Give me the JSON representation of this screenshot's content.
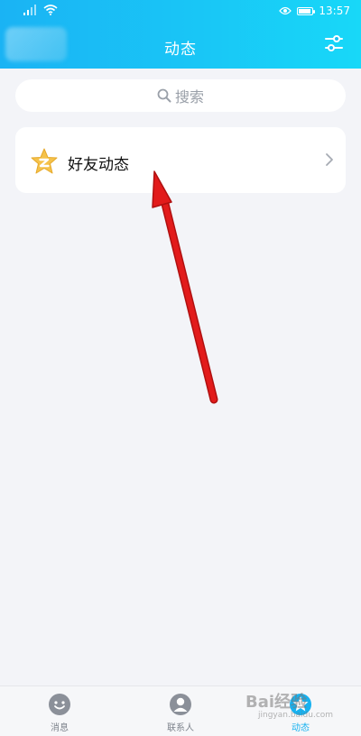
{
  "status_bar": {
    "time": "13:57"
  },
  "header": {
    "title": "动态",
    "filter_icon": "sliders-icon"
  },
  "search": {
    "placeholder": "搜索"
  },
  "feed": {
    "items": [
      {
        "label": "好友动态",
        "icon": "qzone-star-icon"
      }
    ]
  },
  "tab_bar": {
    "items": [
      {
        "label": "消息",
        "icon": "message-icon",
        "active": false
      },
      {
        "label": "联系人",
        "icon": "contacts-icon",
        "active": false
      },
      {
        "label": "动态",
        "icon": "feed-icon",
        "active": true
      }
    ]
  },
  "watermark": {
    "text": "Bai经验",
    "sub": "jingyan.baidu.com"
  },
  "colors": {
    "header_start": "#1ab3f4",
    "header_end": "#18d8f8",
    "accent": "#16b1f0",
    "annotation_red": "#e21b1b",
    "qzone_yellow": "#f5c24a"
  }
}
